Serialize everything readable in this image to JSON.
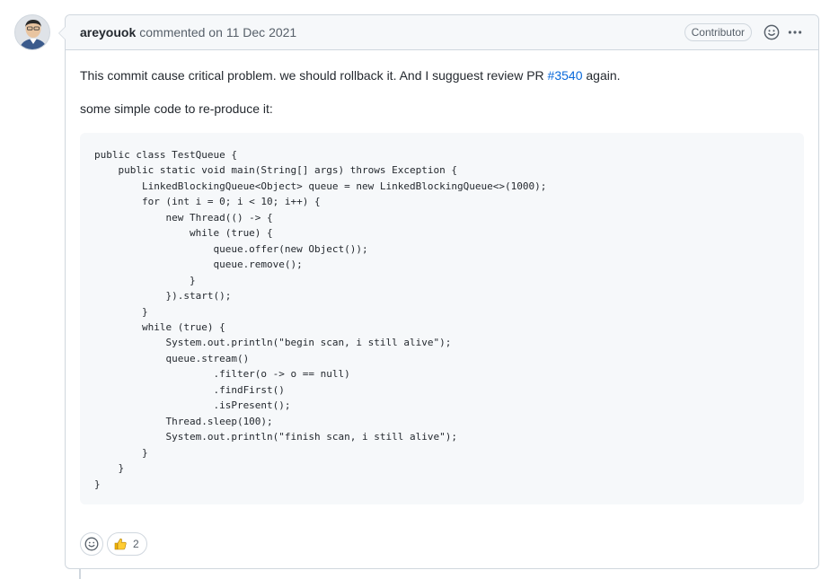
{
  "comment": {
    "author": "areyouok",
    "action_text": "commented on",
    "date": "11 Dec 2021",
    "role_badge": "Contributor",
    "body": {
      "paragraph1_before": "This commit cause critical problem. we should rollback it. And I sugguest review PR ",
      "pr_link": "#3540",
      "paragraph1_after": " again.",
      "paragraph2": "some simple code to re-produce it:",
      "code": "public class TestQueue {\n    public static void main(String[] args) throws Exception {\n        LinkedBlockingQueue<Object> queue = new LinkedBlockingQueue<>(1000);\n        for (int i = 0; i < 10; i++) {\n            new Thread(() -> {\n                while (true) {\n                    queue.offer(new Object());\n                    queue.remove();\n                }\n            }).start();\n        }\n        while (true) {\n            System.out.println(\"begin scan, i still alive\");\n            queue.stream()\n                    .filter(o -> o == null)\n                    .findFirst()\n                    .isPresent();\n            Thread.sleep(100);\n            System.out.println(\"finish scan, i still alive\");\n        }\n    }\n}"
    },
    "reactions": [
      {
        "emoji": "👍",
        "icon": "thumbs-up-icon",
        "count": "2"
      }
    ]
  },
  "icons": {
    "smiley": "smiley-icon",
    "kebab": "kebab-horizontal-icon"
  },
  "colors": {
    "link": "#0969da",
    "border": "#d0d7de",
    "header_bg": "#f6f8fa",
    "code_bg": "#f6f8fa"
  }
}
